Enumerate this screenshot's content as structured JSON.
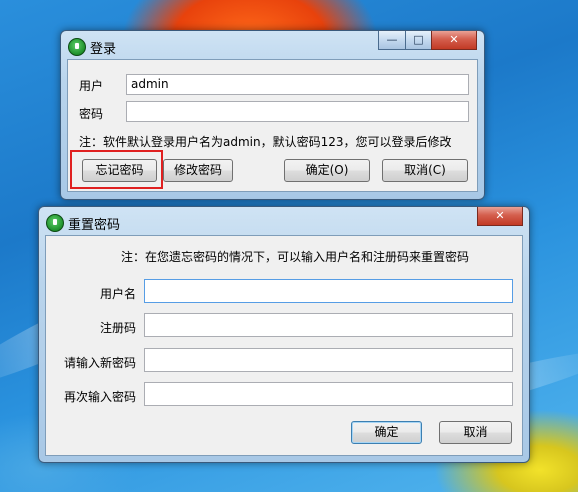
{
  "login_window": {
    "title": "登录",
    "caption_buttons": {
      "minimize": "—",
      "maximize": "□",
      "close": "✕"
    },
    "username_label": "用户",
    "username_value": "admin",
    "password_label": "密码",
    "password_value": "",
    "note": "注：软件默认登录用户名为admin，默认密码123，您可以登录后修改",
    "forgot_button": "忘记密码",
    "change_button": "修改密码",
    "ok_button": "确定(O)",
    "cancel_button": "取消(C)"
  },
  "reset_window": {
    "title": "重置密码",
    "close_label": "✕",
    "note": "注：在您遗忘密码的情况下，可以输入用户名和注册码来重置密码",
    "fields": [
      {
        "label": "用户名",
        "value": ""
      },
      {
        "label": "注册码",
        "value": ""
      },
      {
        "label": "请输入新密码",
        "value": ""
      },
      {
        "label": "再次输入密码",
        "value": ""
      }
    ],
    "ok_button": "确定",
    "cancel_button": "取消"
  },
  "colors": {
    "highlight": "#e02020",
    "close_button": "#c23a25",
    "desktop": "#1c79c9"
  }
}
